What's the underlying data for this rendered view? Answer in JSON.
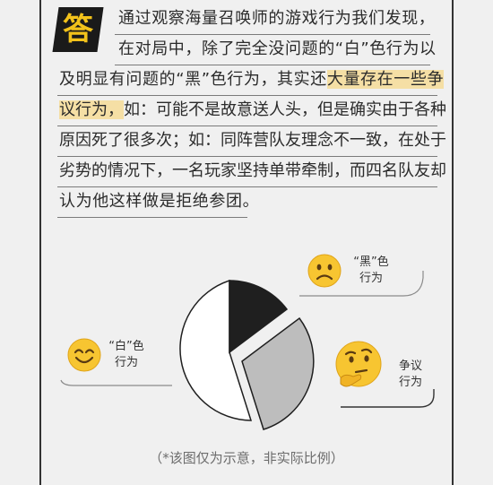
{
  "badge_char": "答",
  "paragraph": {
    "l1": "通过观察海量召唤师的游戏行为我们发现，",
    "l2": "在对局中，除了完全没问题的“白”色行为以",
    "l3": "及明显有问题的“黑”色行为，其实还",
    "l3_hl": "大量存在一些争",
    "l4_hl": "议行为，",
    "l4_rest": "如：可能不是故意送人头，但是确实由于各种",
    "l5": "原因死了很多次；如：同阵营队友理念不一致，在处于",
    "l6": "劣势的情况下，一名玩家坚持单带牵制，而四名队友却",
    "l7": "认为他这样做是拒绝参团。"
  },
  "labels": {
    "black": [
      "“黑”色",
      "行为"
    ],
    "white": [
      "“白”色",
      "行为"
    ],
    "gray": [
      "争议",
      "行为"
    ]
  },
  "caption": "（*该图仅为示意，非实际比例）",
  "colors": {
    "background": "#f0f0f0",
    "black_slice": "#1f1f1f",
    "white_slice": "#ffffff",
    "gray_slice": "#bdbdbd",
    "highlight": "#f5dfa5",
    "badge_text": "#f2c21b"
  },
  "icons": {
    "black": "frowning-face-icon",
    "white": "smiling-face-icon",
    "gray": "thinking-face-icon"
  }
}
